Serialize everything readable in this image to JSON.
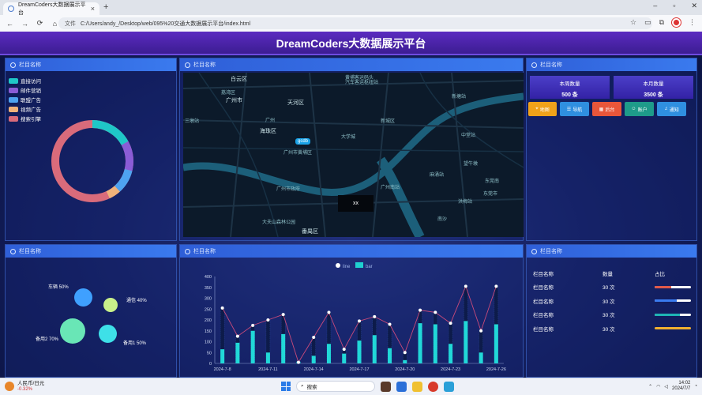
{
  "browser": {
    "tab_title": "DreamCoders大数据展示平台",
    "new_tab": "+",
    "window_buttons": [
      "–",
      "▫",
      "✕"
    ],
    "security_label": "文件",
    "url": "C:/Users/andy_/Desktop/web/095%20交通大数据展示平台/index.html",
    "nav": {
      "back": "←",
      "forward": "→",
      "reload": "⟳",
      "home": "⌂"
    }
  },
  "dashboard": {
    "title": "DreamCoders大数据展示平台",
    "panel_title": "栏目名称",
    "legend1": [
      {
        "label": "直接访问",
        "color": "#1fc7c7"
      },
      {
        "label": "邮件营销",
        "color": "#8a5cd6"
      },
      {
        "label": "联盟广告",
        "color": "#4ea3f0"
      },
      {
        "label": "视频广告",
        "color": "#f0b27a"
      },
      {
        "label": "搜索引擎",
        "color": "#d96b7b"
      }
    ],
    "map": {
      "button": "xx",
      "pin": "gcdb",
      "labels": [
        {
          "t": "白云区",
          "cls": "big"
        },
        {
          "t": "黄埔客运码头"
        },
        {
          "t": "汽车客运枢纽站"
        },
        {
          "t": "广州市",
          "cls": "big"
        },
        {
          "t": "天河区",
          "cls": "big"
        },
        {
          "t": "广州"
        },
        {
          "t": "新城区"
        },
        {
          "t": "海珠区",
          "cls": "big"
        },
        {
          "t": "广州市黄埔区"
        },
        {
          "t": "东莞市"
        },
        {
          "t": "番禺区",
          "cls": "big"
        },
        {
          "t": "荔湾区"
        },
        {
          "t": "广州南站"
        },
        {
          "t": "三墩站"
        },
        {
          "t": "广州市政府"
        },
        {
          "t": "大学城"
        },
        {
          "t": "新塘站"
        },
        {
          "t": "中堂站"
        },
        {
          "t": "望牛墩"
        },
        {
          "t": "东莞南"
        },
        {
          "t": "麻涌站"
        },
        {
          "t": "洪梅站"
        },
        {
          "t": "大夫山森林公园"
        },
        {
          "t": "南沙"
        }
      ]
    },
    "stats": [
      {
        "label": "本周数量",
        "value": "500 条"
      },
      {
        "label": "本月数量",
        "value": "3500 条"
      }
    ],
    "buttons": [
      {
        "label": "地图",
        "color": "#f0a21a",
        "icon": "pin"
      },
      {
        "label": "导航",
        "color": "#2f8fe0",
        "icon": "list"
      },
      {
        "label": "后台",
        "color": "#e8563a",
        "icon": "grid"
      },
      {
        "label": "账户",
        "color": "#1e9b8a",
        "icon": "user"
      },
      {
        "label": "通知",
        "color": "#2f8fe0",
        "icon": "bell"
      }
    ],
    "bubbles": [
      {
        "label": "车辆 50%",
        "color": "#3fa0ff"
      },
      {
        "label": "通信 40%",
        "color": "#c8f08a"
      },
      {
        "label": "备用2 70%",
        "color": "#69e6b6"
      },
      {
        "label": "备用1 50%",
        "color": "#3ee0e8"
      }
    ],
    "chart_data": {
      "type": "bar",
      "legend": [
        "line",
        "bar"
      ],
      "ylim": [
        0,
        400
      ],
      "yticks": [
        "0",
        "50",
        "100",
        "150",
        "200",
        "250",
        "300",
        "350",
        "400"
      ],
      "x_tick_labels": [
        "2024-7-8",
        "2024-7-11",
        "2024-7-14",
        "2024-7-17",
        "2024-7-20",
        "2024-7-23",
        "2024-7-26"
      ],
      "series": [
        {
          "name": "line",
          "values": [
            255,
            125,
            175,
            200,
            225,
            5,
            120,
            235,
            65,
            195,
            215,
            180,
            50,
            245,
            235,
            185,
            355,
            150,
            355
          ]
        },
        {
          "name": "bar",
          "values": [
            65,
            95,
            150,
            50,
            135,
            8,
            35,
            90,
            45,
            105,
            130,
            70,
            15,
            185,
            180,
            90,
            195,
            50,
            180
          ]
        }
      ]
    },
    "table": {
      "headers": [
        "栏目名称",
        "数量",
        "占比"
      ],
      "rows": [
        {
          "name": "栏目名称",
          "count": "30 次",
          "color": "#e05a4a"
        },
        {
          "name": "栏目名称",
          "count": "30 次",
          "color": "#3a7bf0"
        },
        {
          "name": "栏目名称",
          "count": "30 次",
          "color": "#1eb5b5"
        },
        {
          "name": "栏目名称",
          "count": "30 次",
          "color": "#f0b030"
        }
      ]
    }
  },
  "taskbar": {
    "weather_title": "人民币/日元",
    "weather_value": "-0.32%",
    "search": "搜索",
    "time": "14:02",
    "date": "2024/7/7"
  }
}
